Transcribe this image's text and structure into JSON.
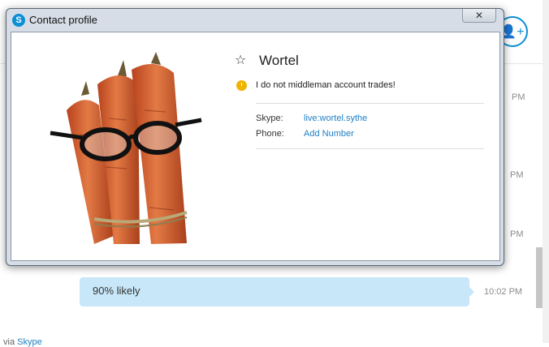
{
  "background": {
    "times": [
      "PM",
      "PM",
      "PM"
    ],
    "message": {
      "text": "90% likely",
      "time": "10:02 PM"
    },
    "footer": {
      "prefix": "via",
      "link": "Skype"
    }
  },
  "dialog": {
    "title": "Contact profile",
    "close_glyph": "✕",
    "contact": {
      "name": "Wortel",
      "mood": "I do not middleman account trades!",
      "fields": [
        {
          "label": "Skype:",
          "value": "live:wortel.sythe"
        },
        {
          "label": "Phone:",
          "value": "Add Number"
        }
      ]
    }
  },
  "colors": {
    "accent": "#0d8fd6",
    "link": "#1d7fc5",
    "bubble": "#c8e7f8",
    "mood": "#f0b400"
  },
  "icons": [
    "skype-logo-icon",
    "close-icon",
    "star-icon",
    "clock-icon",
    "add-contact-icon"
  ]
}
